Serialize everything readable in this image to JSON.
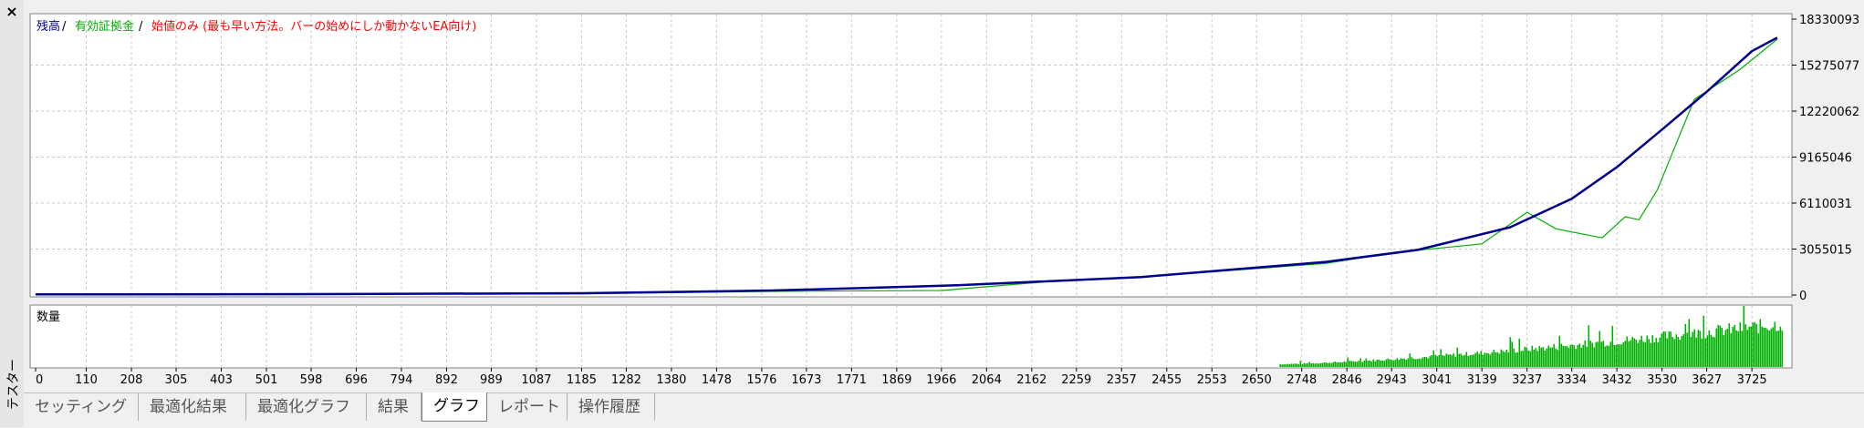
{
  "side_label": "テスター",
  "close_symbol": "×",
  "tabs": [
    {
      "label": "セッティング"
    },
    {
      "label": "最適化結果"
    },
    {
      "label": "最適化グラフ"
    },
    {
      "label": "結果"
    },
    {
      "label": "グラフ",
      "active": true
    },
    {
      "label": "レポート"
    },
    {
      "label": "操作履歴"
    }
  ],
  "legend": {
    "balance": "残高",
    "sep1": " / ",
    "equity": "有効証拠金",
    "sep2": " / ",
    "note": "始値のみ (最も早い方法。バーの始めにしか動かないEA向け)"
  },
  "volume_label": "数量",
  "colors": {
    "balance": "#00008b",
    "equity": "#00b000",
    "note": "#ff0000",
    "volume": "#00b000",
    "grid": "#c8c8c8"
  },
  "chart_data": {
    "type": "line",
    "ylim": [
      0,
      18330093
    ],
    "yticks": [
      "18330093",
      "15275077",
      "12220062",
      "9165046",
      "6110031",
      "3055015",
      "0"
    ],
    "xticks": [
      "0",
      "110",
      "208",
      "305",
      "403",
      "501",
      "598",
      "696",
      "794",
      "892",
      "989",
      "1087",
      "1185",
      "1282",
      "1380",
      "1478",
      "1576",
      "1673",
      "1771",
      "1869",
      "1966",
      "2064",
      "2162",
      "2259",
      "2357",
      "2455",
      "2553",
      "2650",
      "2748",
      "2846",
      "2943",
      "3041",
      "3139",
      "3237",
      "3334",
      "3432",
      "3530",
      "3627",
      "3725"
    ],
    "x_max": 3800,
    "series": [
      {
        "name": "残高",
        "x": [
          0,
          600,
          1185,
          1600,
          2000,
          2400,
          2800,
          3000,
          3200,
          3334,
          3432,
          3530,
          3627,
          3725,
          3780
        ],
        "y": [
          40000,
          60000,
          120000,
          300000,
          650000,
          1200000,
          2200000,
          3000000,
          4500000,
          6400000,
          8500000,
          11000000,
          13500000,
          16200000,
          17100000
        ]
      },
      {
        "name": "有効証拠金",
        "x": [
          0,
          1185,
          1600,
          1966,
          2200,
          2400,
          2800,
          2943,
          3139,
          3237,
          3300,
          3400,
          3450,
          3480,
          3520,
          3600,
          3700,
          3780
        ],
        "y": [
          40000,
          80000,
          250000,
          300000,
          900000,
          1200000,
          2100000,
          2800000,
          3400000,
          5500000,
          4400000,
          3800000,
          5200000,
          5000000,
          7000000,
          13000000,
          15000000,
          17000000
        ]
      }
    ],
    "volume": {
      "label": "数量",
      "start_x": 2700,
      "start_height": 0.05,
      "end_height": 0.75
    }
  }
}
